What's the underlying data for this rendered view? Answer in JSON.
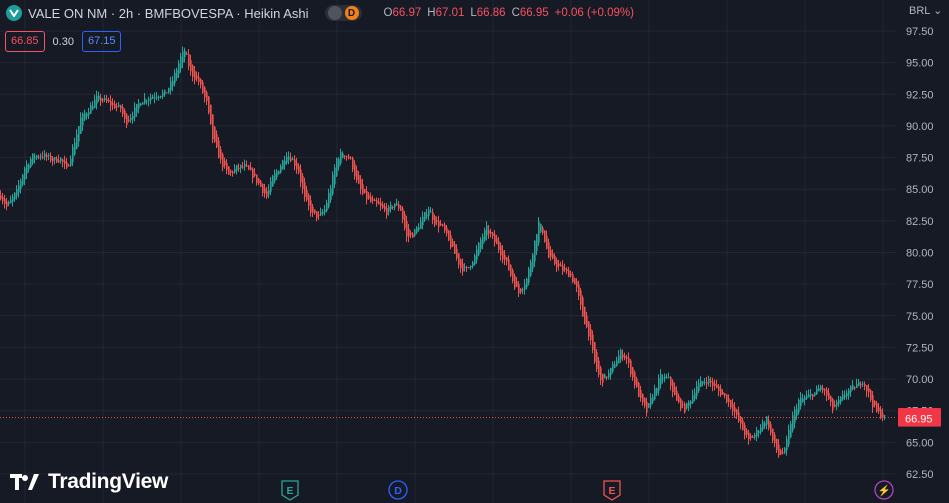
{
  "header": {
    "symbol_title": "VALE ON NM · 2h · BMFBOVESPA · Heikin Ashi",
    "badge_d": "D",
    "ohlc": {
      "o_label": "O",
      "o_value": "66.97",
      "h_label": "H",
      "h_value": "67.01",
      "l_label": "L",
      "l_value": "66.86",
      "c_label": "C",
      "c_value": "66.95",
      "change": "+0.06 (+0.09%)"
    }
  },
  "trade": {
    "sell_price": "66.85",
    "spread": "0.30",
    "buy_price": "67.15"
  },
  "currency_label": "BRL",
  "logo_text": "TradingView",
  "colors": {
    "background": "#161a25",
    "up": "#26a69a",
    "down": "#ef5350",
    "grid": "#232733",
    "axis_text": "#b2b5be"
  },
  "chart_data": {
    "type": "candlestick",
    "style": "Heikin Ashi",
    "interval": "2h",
    "ylim": [
      62.5,
      97.5
    ],
    "y_ticks": [
      "97.50",
      "95.00",
      "92.50",
      "90.00",
      "87.50",
      "85.00",
      "82.50",
      "80.00",
      "77.50",
      "75.00",
      "72.50",
      "70.00",
      "67.50",
      "65.00",
      "62.50"
    ],
    "last_price": "66.95",
    "price_label_above": "67.00",
    "grid": true,
    "close_path": [
      [
        0,
        84.5
      ],
      [
        6,
        83.6
      ],
      [
        16,
        84.8
      ],
      [
        24,
        86.7
      ],
      [
        32,
        87.6
      ],
      [
        42,
        87.7
      ],
      [
        52,
        87.3
      ],
      [
        60,
        87.4
      ],
      [
        66,
        86.5
      ],
      [
        74,
        88.8
      ],
      [
        80,
        90.6
      ],
      [
        88,
        91.3
      ],
      [
        96,
        92.2
      ],
      [
        104,
        92.0
      ],
      [
        112,
        91.6
      ],
      [
        120,
        91.4
      ],
      [
        125,
        90.2
      ],
      [
        132,
        91.0
      ],
      [
        140,
        92.0
      ],
      [
        150,
        92.3
      ],
      [
        158,
        92.5
      ],
      [
        165,
        92.6
      ],
      [
        172,
        93.6
      ],
      [
        180,
        95.4
      ],
      [
        184,
        96.0
      ],
      [
        190,
        94.2
      ],
      [
        198,
        93.5
      ],
      [
        206,
        91.8
      ],
      [
        212,
        89.0
      ],
      [
        220,
        87.2
      ],
      [
        228,
        86.1
      ],
      [
        236,
        86.7
      ],
      [
        244,
        86.8
      ],
      [
        252,
        86.1
      ],
      [
        260,
        85.2
      ],
      [
        266,
        84.4
      ],
      [
        272,
        85.9
      ],
      [
        280,
        86.9
      ],
      [
        286,
        87.8
      ],
      [
        292,
        87.3
      ],
      [
        298,
        86.4
      ],
      [
        304,
        84.2
      ],
      [
        312,
        83.0
      ],
      [
        318,
        82.8
      ],
      [
        324,
        83.4
      ],
      [
        330,
        85.2
      ],
      [
        336,
        87.4
      ],
      [
        342,
        87.9
      ],
      [
        350,
        87.3
      ],
      [
        356,
        85.6
      ],
      [
        362,
        84.6
      ],
      [
        370,
        84.0
      ],
      [
        378,
        83.7
      ],
      [
        386,
        83.2
      ],
      [
        394,
        83.9
      ],
      [
        400,
        83.4
      ],
      [
        406,
        81.2
      ],
      [
        412,
        81.4
      ],
      [
        420,
        82.4
      ],
      [
        428,
        83.5
      ],
      [
        434,
        82.4
      ],
      [
        442,
        82.0
      ],
      [
        448,
        80.9
      ],
      [
        454,
        79.9
      ],
      [
        460,
        78.8
      ],
      [
        466,
        78.6
      ],
      [
        474,
        79.7
      ],
      [
        480,
        81.0
      ],
      [
        486,
        81.9
      ],
      [
        492,
        81.1
      ],
      [
        498,
        80.3
      ],
      [
        506,
        79.1
      ],
      [
        512,
        77.8
      ],
      [
        518,
        76.8
      ],
      [
        526,
        77.9
      ],
      [
        532,
        80.1
      ],
      [
        538,
        82.4
      ],
      [
        542,
        81.7
      ],
      [
        548,
        79.6
      ],
      [
        556,
        79.0
      ],
      [
        562,
        78.6
      ],
      [
        570,
        78.2
      ],
      [
        576,
        77.1
      ],
      [
        582,
        75.0
      ],
      [
        588,
        73.6
      ],
      [
        594,
        71.3
      ],
      [
        600,
        69.8
      ],
      [
        608,
        70.4
      ],
      [
        614,
        71.3
      ],
      [
        620,
        72.1
      ],
      [
        626,
        71.6
      ],
      [
        632,
        70.1
      ],
      [
        640,
        68.3
      ],
      [
        646,
        67.4
      ],
      [
        652,
        68.8
      ],
      [
        660,
        70.2
      ],
      [
        668,
        70.0
      ],
      [
        676,
        68.2
      ],
      [
        684,
        67.6
      ],
      [
        690,
        68.4
      ],
      [
        696,
        69.5
      ],
      [
        702,
        69.8
      ],
      [
        708,
        69.9
      ],
      [
        716,
        69.2
      ],
      [
        724,
        68.6
      ],
      [
        732,
        67.7
      ],
      [
        740,
        66.3
      ],
      [
        748,
        65.1
      ],
      [
        754,
        65.6
      ],
      [
        760,
        66.3
      ],
      [
        766,
        66.9
      ],
      [
        772,
        65.1
      ],
      [
        778,
        64.0
      ],
      [
        784,
        64.3
      ],
      [
        790,
        66.6
      ],
      [
        798,
        68.3
      ],
      [
        806,
        68.6
      ],
      [
        814,
        68.9
      ],
      [
        820,
        69.4
      ],
      [
        826,
        68.7
      ],
      [
        832,
        67.6
      ],
      [
        840,
        68.4
      ],
      [
        846,
        69.0
      ],
      [
        852,
        69.3
      ],
      [
        858,
        69.6
      ],
      [
        862,
        69.9
      ],
      [
        868,
        68.8
      ],
      [
        872,
        68.0
      ],
      [
        876,
        67.4
      ],
      [
        884,
        66.95
      ]
    ],
    "event_markers": [
      {
        "label": "E",
        "kind": "earnings",
        "color": "#26a69a",
        "at_candle": 290
      },
      {
        "label": "D",
        "kind": "dividend",
        "color": "#2962ff",
        "at_candle": 398
      },
      {
        "label": "E",
        "kind": "earnings",
        "color": "#ef5350",
        "at_candle": 612
      },
      {
        "label": "⚡",
        "kind": "news",
        "color": "#ab47bc",
        "at_candle": 884
      }
    ]
  }
}
